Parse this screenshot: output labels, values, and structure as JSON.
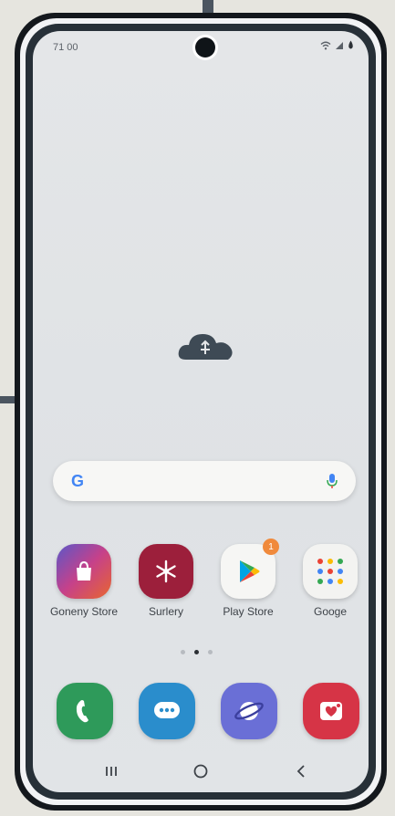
{
  "status_bar": {
    "time": "71 00"
  },
  "search_bar": {
    "google_glyph": "G"
  },
  "apps": [
    {
      "label": "Goneny Store",
      "icon": "shopping-bag-icon",
      "color": "#8a4fb8"
    },
    {
      "label": "Surlery",
      "icon": "snowflake-icon",
      "color": "#9c1f3b"
    },
    {
      "label": "Play Store",
      "icon": "play-triangle-icon",
      "color": "#f6f6f4",
      "badge": "1"
    },
    {
      "label": "Googe",
      "icon": "google-apps-folder-icon",
      "color": "#f3f3f1"
    }
  ],
  "dock": [
    {
      "icon": "phone-icon",
      "color": "#2e9a5a"
    },
    {
      "icon": "messages-icon",
      "color": "#2a8dcc"
    },
    {
      "icon": "browser-icon",
      "color": "#6a6fd6"
    },
    {
      "icon": "gallery-icon",
      "color": "#d63446"
    }
  ],
  "page_indicator": {
    "total": 3,
    "active": 2
  },
  "nav": {
    "recents_icon": "recents-icon",
    "home_icon": "home-icon",
    "back_icon": "back-icon"
  }
}
